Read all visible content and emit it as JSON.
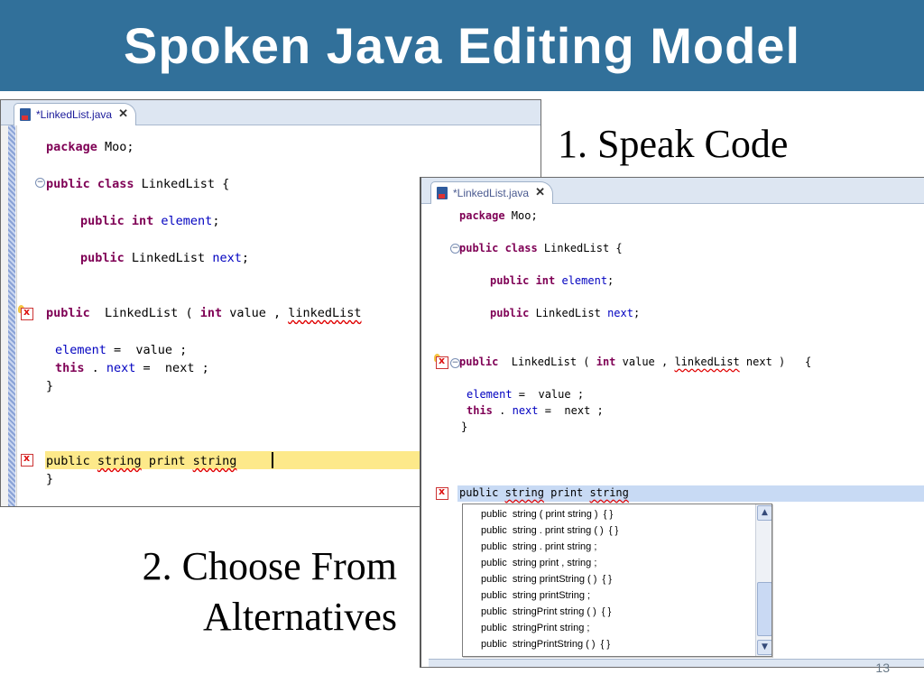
{
  "slide": {
    "title": "Spoken Java Editing Model",
    "caption_step1": "1. Speak Code",
    "caption_step2_line1": "2. Choose From",
    "caption_step2_line2": "Alternatives",
    "page_number": "13"
  },
  "editor_top": {
    "tab_label": "*LinkedList.java",
    "close_glyph": "✕",
    "code": {
      "l1_kw": "package",
      "l1_rest": " Moo;",
      "l2_kw": "public class",
      "l2_rest": " LinkedList {",
      "l3_kw": "public int",
      "l3_field": " element",
      "l3_end": ";",
      "l4_kw": "public",
      "l4_mid": " LinkedList ",
      "l4_field": "next",
      "l4_end": ";",
      "l5_kw": "public",
      "l5_mid": "  LinkedList ( ",
      "l5_kw2": "int",
      "l5_mid2": " value , ",
      "l5_err": "linkedList",
      "l6_field": "element",
      "l6_rest": " =  value ;",
      "l7_kw": "this",
      "l7_mid": " . ",
      "l7_field": "next",
      "l7_rest": " =  next ;",
      "l8": "}",
      "l9_a": "public ",
      "l9_err1": "string",
      "l9_b": " print ",
      "l9_err2": "string",
      "l10": "}"
    }
  },
  "editor_bottom": {
    "tab_label": "*LinkedList.java",
    "close_glyph": "✕",
    "code": {
      "l1_kw": "package",
      "l1_rest": " Moo;",
      "l2_kw": "public class",
      "l2_rest": " LinkedList {",
      "l3_kw": "public int",
      "l3_field": " element",
      "l3_end": ";",
      "l4_kw": "public",
      "l4_mid": " LinkedList ",
      "l4_field": "next",
      "l4_end": ";",
      "l5_kw": "public",
      "l5_mid": "  LinkedList ( ",
      "l5_kw2": "int",
      "l5_mid2": " value , ",
      "l5_err": "linkedList",
      "l5_end": " next )   {",
      "l6_field": "element",
      "l6_rest": " =  value ;",
      "l7_kw": "this",
      "l7_mid": " . ",
      "l7_field": "next",
      "l7_rest": " =  next ;",
      "l8": "}",
      "l9_a": "public ",
      "l9_err1": "string",
      "l9_b": " print ",
      "l9_err2": "string"
    },
    "alternatives": [
      "public  string ( print string )  { }",
      "public  string . print string ( )  { }",
      "public  string . print string ;",
      "public  string print , string ;",
      "public  string printString ( )  { }",
      "public  string printString ;",
      "public  stringPrint string ( )  { }",
      "public  stringPrint string ;",
      "public  stringPrintString ( )  { }"
    ],
    "scroll_up_glyph": "▲",
    "scroll_down_glyph": "▼"
  },
  "colors": {
    "title_bar": "#31709a",
    "keyword": "#7f0055",
    "field": "#0000c0",
    "current_line_top": "#fde98a",
    "current_line_bottom": "#c8daf4"
  }
}
